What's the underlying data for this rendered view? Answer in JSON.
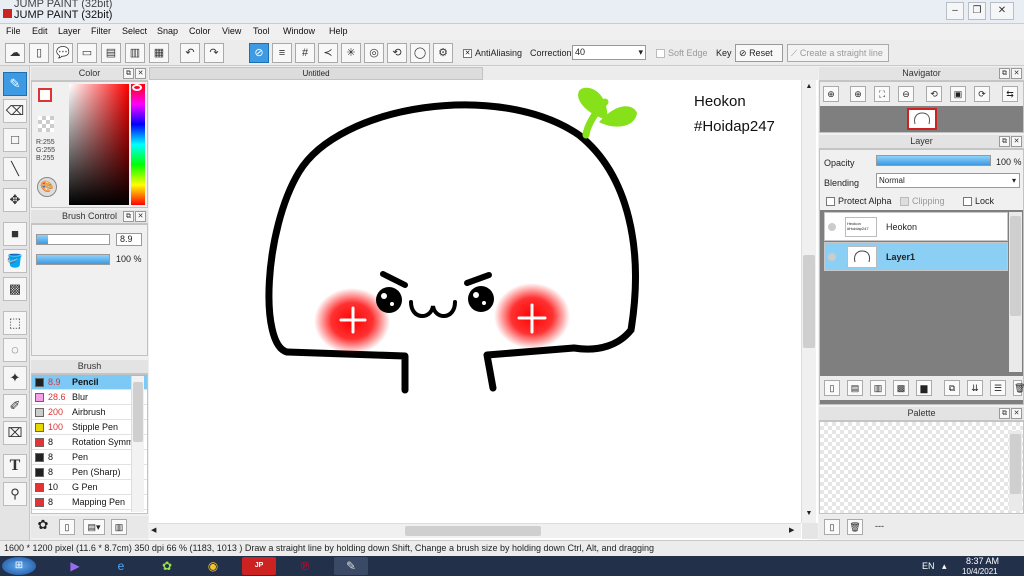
{
  "window": {
    "title_back": "JUMP PAINT (32bit)",
    "title_front": "JUMP PAINT (32bit)"
  },
  "menu": [
    "File",
    "Edit",
    "Layer",
    "Filter",
    "Select",
    "Snap",
    "Color",
    "View",
    "Tool",
    "Window",
    "Help"
  ],
  "toolbar": {
    "antialiasing_label": "AntiAliasing",
    "correction_label": "Correction",
    "correction_value": "40",
    "soft_edge_label": "Soft Edge",
    "key_label": "Key",
    "reset_label": "Reset",
    "straight_line_label": "Create a straight line"
  },
  "color_panel": {
    "title": "Color",
    "r": "R:255",
    "g": "G:255",
    "b": "B:255"
  },
  "brush_control": {
    "title": "Brush Control",
    "size": "8.9",
    "opacity": "100 %"
  },
  "brush_panel": {
    "title": "Brush",
    "items": [
      {
        "size": "8.9",
        "name": "Pencil",
        "color": "#222222",
        "selected": true
      },
      {
        "size": "28.6",
        "name": "Blur",
        "color": "#f4a0e8"
      },
      {
        "size": "200",
        "name": "Airbrush",
        "color": "#cccccc"
      },
      {
        "size": "100",
        "name": "Stipple Pen",
        "color": "#e8d800"
      },
      {
        "size": "8",
        "name": "Rotation Symm",
        "color": "#e53333"
      },
      {
        "size": "8",
        "name": "Pen",
        "color": "#222222"
      },
      {
        "size": "8",
        "name": "Pen (Sharp)",
        "color": "#222222"
      },
      {
        "size": "10",
        "name": "G Pen",
        "color": "#e53333"
      },
      {
        "size": "8",
        "name": "Mapping Pen",
        "color": "#e53333"
      }
    ]
  },
  "document": {
    "tab_title": "Untitled",
    "signature_name": "Heokon",
    "signature_tag": "#Hoidap247"
  },
  "navigator": {
    "title": "Navigator"
  },
  "layer_panel": {
    "title": "Layer",
    "opacity_label": "Opacity",
    "opacity_value": "100 %",
    "blending_label": "Blending",
    "blending_value": "Normal",
    "protect_alpha_label": "Protect Alpha",
    "clipping_label": "Clipping",
    "lock_label": "Lock",
    "layers": [
      {
        "name": "Heokon",
        "selected": false
      },
      {
        "name": "Layer1",
        "selected": true
      }
    ]
  },
  "palette": {
    "title": "Palette",
    "footer": "---"
  },
  "status": {
    "text": "1600 * 1200 pixel   (11.6 * 8.7cm)  350 dpi   66 %   (1183, 1013 )   Draw a straight line by holding down Shift, Change a brush size by holding down Ctrl, Alt, and dragging"
  },
  "taskbar": {
    "lang": "EN",
    "time": "8:37 AM",
    "date": "10/4/2021"
  },
  "colors": {
    "accent": "#3e9ae2",
    "selected_layer": "#8ccff5",
    "sprout": "#86e01a",
    "blush": "#ff1a1a"
  }
}
